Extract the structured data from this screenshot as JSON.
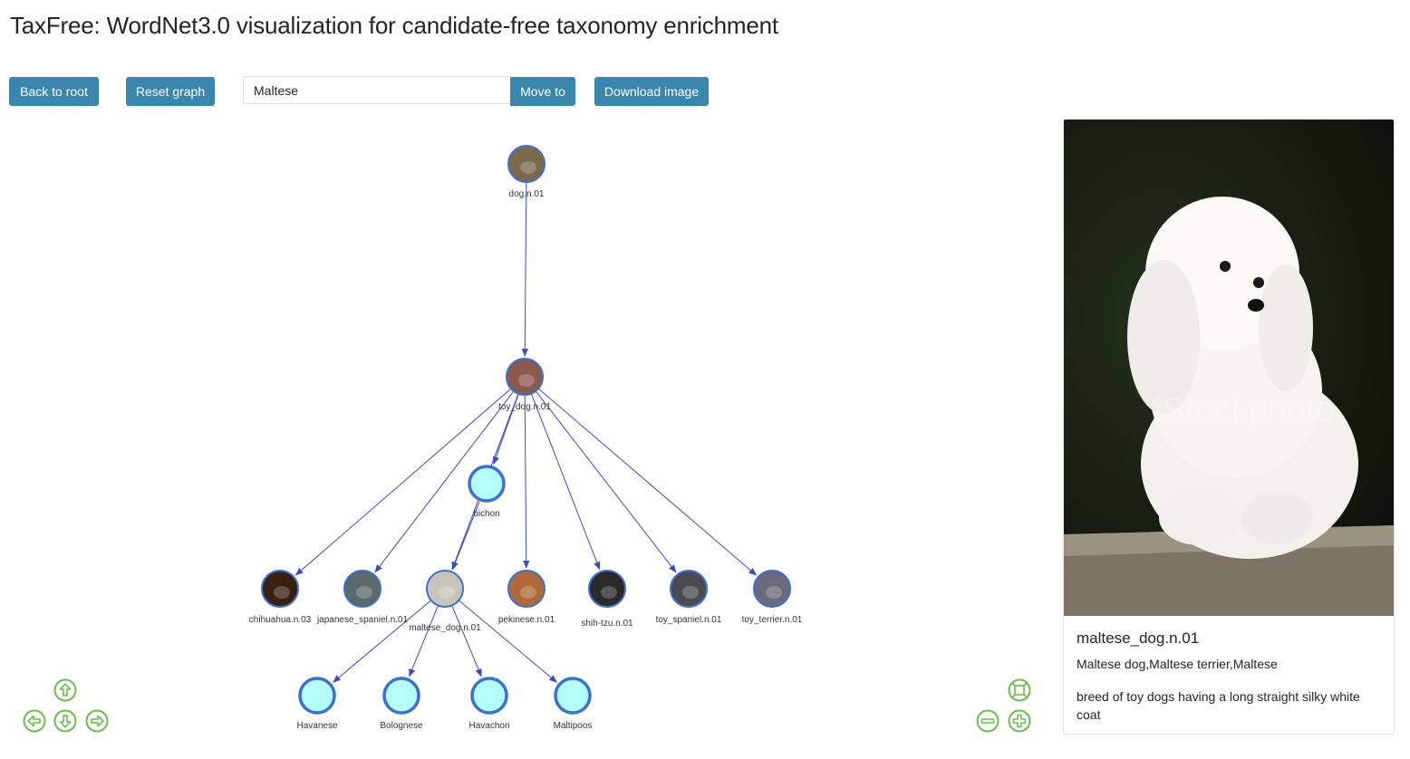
{
  "header": {
    "title": "TaxFree: WordNet3.0 visualization for candidate-free taxonomy enrichment"
  },
  "toolbar": {
    "back_label": "Back to root",
    "reset_label": "Reset graph",
    "search_value": "Maltese",
    "move_label": "Move to",
    "download_label": "Download image"
  },
  "graph": {
    "colors": {
      "edge": "#3b4bc4",
      "node_border": "#3b6fd6",
      "new_node_fill": "#b3ffff"
    },
    "nodes": [
      {
        "id": "dog",
        "label": "dog.n.01",
        "kind": "image",
        "color": "#7a6a4a"
      },
      {
        "id": "toy_dog",
        "label": "toy_dog.n.01",
        "kind": "image",
        "color": "#8b5a4a"
      },
      {
        "id": "bichon",
        "label": "bichon",
        "kind": "new"
      },
      {
        "id": "chihuahua",
        "label": "chihuahua.n.03",
        "kind": "image",
        "color": "#3a2010"
      },
      {
        "id": "japanese_spaniel",
        "label": "japanese_spaniel.n.01",
        "kind": "image",
        "color": "#5a6a6a"
      },
      {
        "id": "maltese",
        "label": "maltese_dog.n.01",
        "kind": "image",
        "color": "#c9c4b8"
      },
      {
        "id": "pekinese",
        "label": "pekinese.n.01",
        "kind": "image",
        "color": "#b06a3a"
      },
      {
        "id": "shih_tzu",
        "label": "shih-tzu.n.01",
        "kind": "image",
        "color": "#2a2a2a"
      },
      {
        "id": "toy_spaniel",
        "label": "toy_spaniel.n.01",
        "kind": "image",
        "color": "#4a4a50"
      },
      {
        "id": "toy_terrier",
        "label": "toy_terrier.n.01",
        "kind": "image",
        "color": "#6a6a7a"
      },
      {
        "id": "havanese",
        "label": "Havanese",
        "kind": "new"
      },
      {
        "id": "bolognese",
        "label": "Bolognese",
        "kind": "new"
      },
      {
        "id": "havachon",
        "label": "Havachon",
        "kind": "new"
      },
      {
        "id": "maltipoos",
        "label": "Maltipoos",
        "kind": "new"
      }
    ],
    "edges": [
      [
        "dog",
        "toy_dog"
      ],
      [
        "toy_dog",
        "bichon"
      ],
      [
        "toy_dog",
        "chihuahua"
      ],
      [
        "toy_dog",
        "japanese_spaniel"
      ],
      [
        "toy_dog",
        "maltese"
      ],
      [
        "toy_dog",
        "pekinese"
      ],
      [
        "toy_dog",
        "shih_tzu"
      ],
      [
        "toy_dog",
        "toy_spaniel"
      ],
      [
        "toy_dog",
        "toy_terrier"
      ],
      [
        "bichon",
        "maltese"
      ],
      [
        "maltese",
        "havanese"
      ],
      [
        "maltese",
        "bolognese"
      ],
      [
        "maltese",
        "havachon"
      ],
      [
        "maltese",
        "maltipoos"
      ]
    ]
  },
  "controls": {
    "color": "#6abf4b",
    "pan_up_icon": "arrow-up-icon",
    "pan_down_icon": "arrow-down-icon",
    "pan_left_icon": "arrow-left-icon",
    "pan_right_icon": "arrow-right-icon",
    "zoom_in_icon": "plus-icon",
    "zoom_out_icon": "minus-icon",
    "fit_icon": "fit-icon"
  },
  "detail": {
    "title": "maltese_dog.n.01",
    "synonyms": "Maltese dog,Maltese terrier,Maltese",
    "definition": "breed of toy dogs having a long straight silky white coat",
    "image_watermark": "iStockphoto"
  }
}
